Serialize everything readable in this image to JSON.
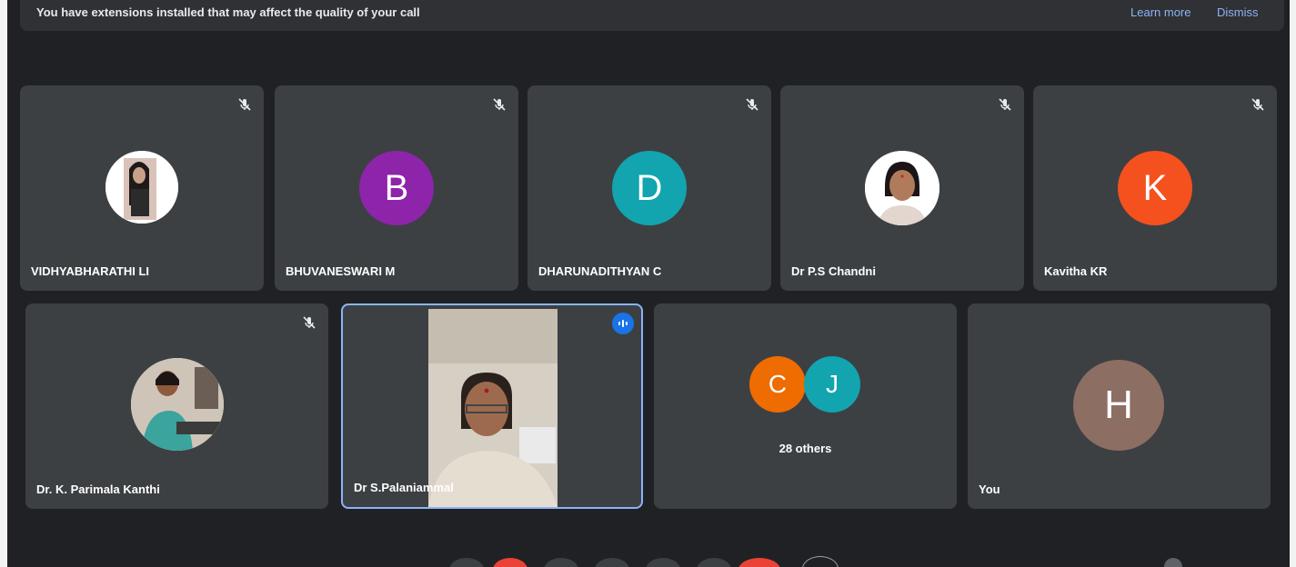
{
  "banner": {
    "message": "You have extensions installed that may affect the quality of your call",
    "learn_more": "Learn more",
    "dismiss": "Dismiss"
  },
  "participants": [
    {
      "name": "VIDHYABHARATHI LI"
    },
    {
      "name": "BHUVANESWARI M",
      "initial": "B",
      "color": "#8e24aa"
    },
    {
      "name": "DHARUNADITHYAN C",
      "initial": "D",
      "color": "#12a4af"
    },
    {
      "name": "Dr P.S Chandni"
    },
    {
      "name": "Kavitha KR",
      "initial": "K",
      "color": "#f4511e"
    },
    {
      "name": "Dr. K. Parimala Kanthi"
    },
    {
      "name": "Dr S.Palaniammal"
    },
    {
      "others_label": "28 others",
      "initials": [
        "C",
        "J"
      ],
      "colors": [
        "#ef6c00",
        "#12a4af"
      ]
    },
    {
      "name": "You",
      "initial": "H",
      "color": "#8d6e63"
    }
  ],
  "colors": {
    "background": "#202124",
    "tile": "#3c4043",
    "accent": "#8ab4f8",
    "active_border": "#8ab4f8"
  }
}
